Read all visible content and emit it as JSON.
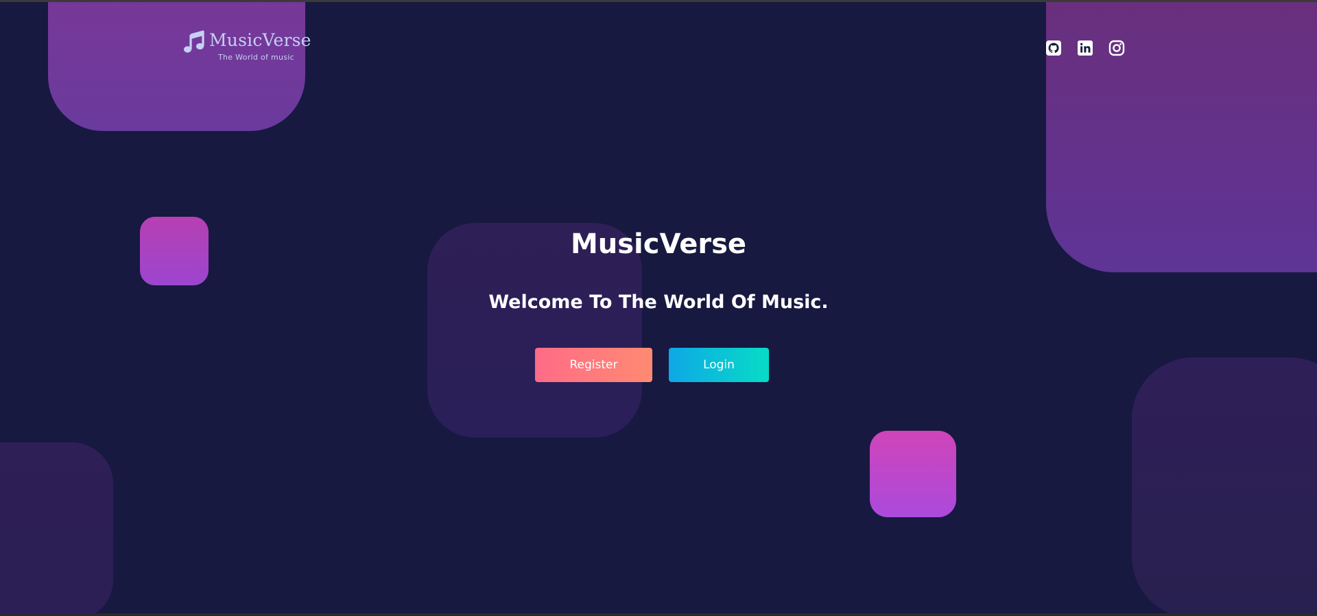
{
  "brand": {
    "name": "MusicVerse",
    "tagline": "The World of music",
    "icon": "music-note-icon",
    "color": "#c6d0f5"
  },
  "socials": [
    {
      "name": "github",
      "icon": "github-icon"
    },
    {
      "name": "linkedin",
      "icon": "linkedin-icon"
    },
    {
      "name": "instagram",
      "icon": "instagram-icon"
    }
  ],
  "hero": {
    "title": "MusicVerse",
    "subtitle": "Welcome To The World Of Music."
  },
  "buttons": {
    "register_label": "Register",
    "login_label": "Login"
  },
  "colors": {
    "background": "#171940",
    "register_gradient": [
      "#ff6b87",
      "#ff8a72"
    ],
    "login_gradient": [
      "#0ea8e6",
      "#07dcc6"
    ],
    "accent_purple": "#6a3a9e",
    "accent_pink": "#d044b8"
  }
}
